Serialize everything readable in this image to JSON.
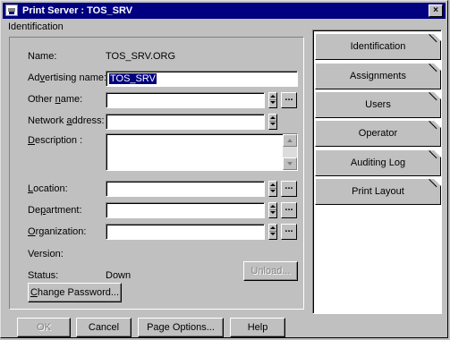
{
  "window": {
    "title": "Print Server : TOS_SRV",
    "close_glyph": "×"
  },
  "group": {
    "label": "Identification"
  },
  "fields": {
    "name": {
      "label": "Name:",
      "value": "TOS_SRV.ORG"
    },
    "advertising": {
      "label_pre": "Ad",
      "label_u": "v",
      "label_post": "ertising name:",
      "value": "TOS_SRV"
    },
    "other": {
      "label_pre": "Other ",
      "label_u": "n",
      "label_post": "ame:",
      "value": ""
    },
    "network": {
      "label_pre": "Network ",
      "label_u": "a",
      "label_post": "ddress:",
      "value": ""
    },
    "description": {
      "label_pre": "",
      "label_u": "D",
      "label_post": "escription :",
      "value": ""
    },
    "location": {
      "label_pre": "",
      "label_u": "L",
      "label_post": "ocation:",
      "value": ""
    },
    "department": {
      "label_pre": "De",
      "label_u": "p",
      "label_post": "artment:",
      "value": ""
    },
    "organization": {
      "label_pre": "",
      "label_u": "O",
      "label_post": "rganization:",
      "value": ""
    },
    "version": {
      "label": "Version:",
      "value": ""
    },
    "status": {
      "label": "Status:",
      "value": "Down"
    }
  },
  "buttons": {
    "ellipsis": "...",
    "unload": "Unload...",
    "change_password_pre": "",
    "change_password_u": "C",
    "change_password_post": "hange Password...",
    "ok": "OK",
    "cancel": "Cancel",
    "page_options": "Page Options...",
    "help": "Help"
  },
  "pages": [
    {
      "label": "Identification"
    },
    {
      "label": "Assignments"
    },
    {
      "label": "Users"
    },
    {
      "label": "Operator"
    },
    {
      "label": "Auditing Log"
    },
    {
      "label": "Print Layout"
    }
  ],
  "icons": {
    "app": "print-server-icon",
    "spin": "spin-arrows-icon",
    "scroll_up": "scroll-up-arrow-icon",
    "scroll_down": "scroll-down-arrow-icon"
  }
}
